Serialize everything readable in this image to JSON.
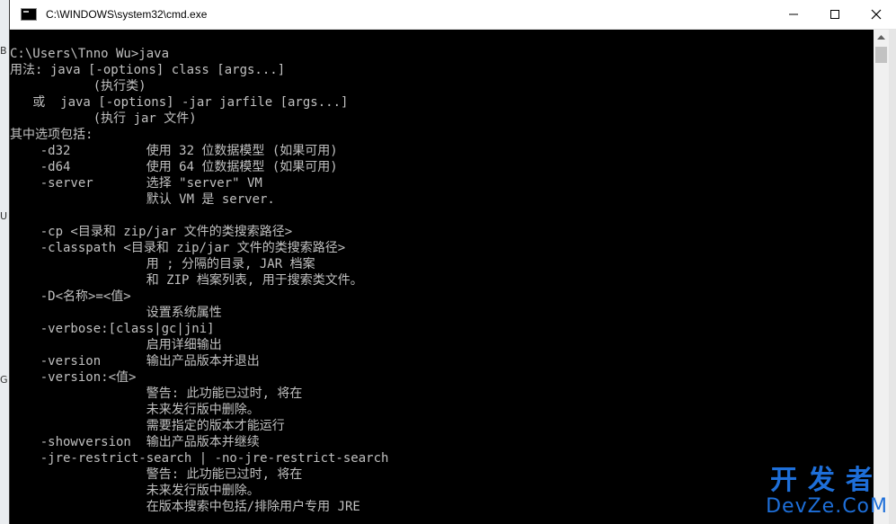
{
  "window": {
    "title": "C:\\WINDOWS\\system32\\cmd.exe",
    "controls": [
      "minimize",
      "maximize",
      "close"
    ]
  },
  "console": {
    "lines": [
      "C:\\Users\\Tnno Wu>java",
      "用法: java [-options] class [args...]",
      "           (执行类)",
      "   或  java [-options] -jar jarfile [args...]",
      "           (执行 jar 文件)",
      "其中选项包括:",
      "    -d32          使用 32 位数据模型 (如果可用)",
      "    -d64          使用 64 位数据模型 (如果可用)",
      "    -server       选择 \"server\" VM",
      "                  默认 VM 是 server.",
      "",
      "    -cp <目录和 zip/jar 文件的类搜索路径>",
      "    -classpath <目录和 zip/jar 文件的类搜索路径>",
      "                  用 ; 分隔的目录, JAR 档案",
      "                  和 ZIP 档案列表, 用于搜索类文件。",
      "    -D<名称>=<值>",
      "                  设置系统属性",
      "    -verbose:[class|gc|jni]",
      "                  启用详细输出",
      "    -version      输出产品版本并退出",
      "    -version:<值>",
      "                  警告: 此功能已过时, 将在",
      "                  未来发行版中删除。",
      "                  需要指定的版本才能运行",
      "    -showversion  输出产品版本并继续",
      "    -jre-restrict-search | -no-jre-restrict-search",
      "                  警告: 此功能已过时, 将在",
      "                  未来发行版中删除。",
      "                  在版本搜索中包括/排除用户专用 JRE"
    ]
  },
  "watermark": {
    "cn": "开发者",
    "en": "DevZe.CoM"
  },
  "colors": {
    "console_bg": "#000000",
    "console_fg": "#c0c0c0",
    "watermark": "#1e6fd9"
  }
}
